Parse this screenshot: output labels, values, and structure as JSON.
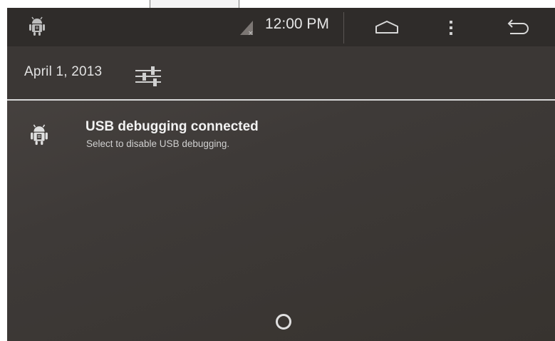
{
  "status_bar": {
    "time": "12:00 PM",
    "icons": [
      "android-debug-icon",
      "signal-icon",
      "home-icon",
      "menu-icon",
      "back-icon"
    ]
  },
  "header": {
    "date": "April 1, 2013",
    "settings_icon": "quick-settings-icon"
  },
  "notifications": [
    {
      "icon": "android-debug-icon",
      "title": "USB debugging connected",
      "text": "Select to disable USB debugging."
    }
  ],
  "colors": {
    "background": "#3e3a38",
    "status_bar": "#2f2c2a",
    "text": "#f2f2f2",
    "divider": "#d8d8d8"
  }
}
